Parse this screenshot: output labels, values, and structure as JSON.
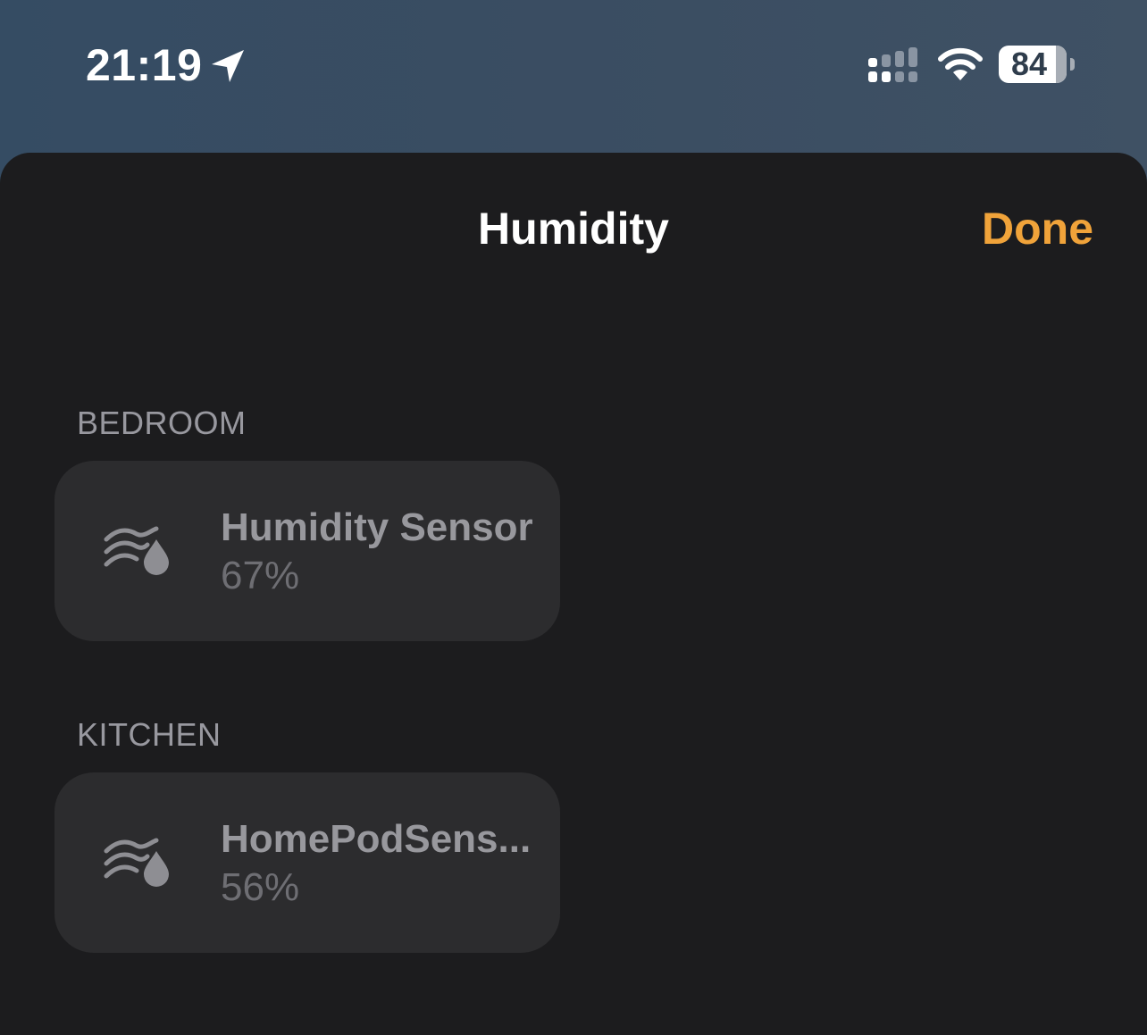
{
  "status_bar": {
    "time": "21:19",
    "location_icon": "location-arrow-icon",
    "signal_icon": "cellular-signal-icon",
    "wifi_icon": "wifi-icon",
    "battery_level": "84",
    "battery_fraction": 0.84
  },
  "sheet": {
    "title": "Humidity",
    "done_label": "Done"
  },
  "sections": [
    {
      "header": "BEDROOM",
      "accessories": [
        {
          "name": "Humidity Sensor",
          "value": "67%",
          "icon": "humidity-icon"
        }
      ]
    },
    {
      "header": "KITCHEN",
      "accessories": [
        {
          "name": "HomePodSens...",
          "value": "56%",
          "icon": "humidity-icon"
        }
      ]
    }
  ],
  "colors": {
    "accent": "#f0a33a",
    "sheet_background": "#1c1c1e",
    "tile_background": "#2c2c2e"
  }
}
